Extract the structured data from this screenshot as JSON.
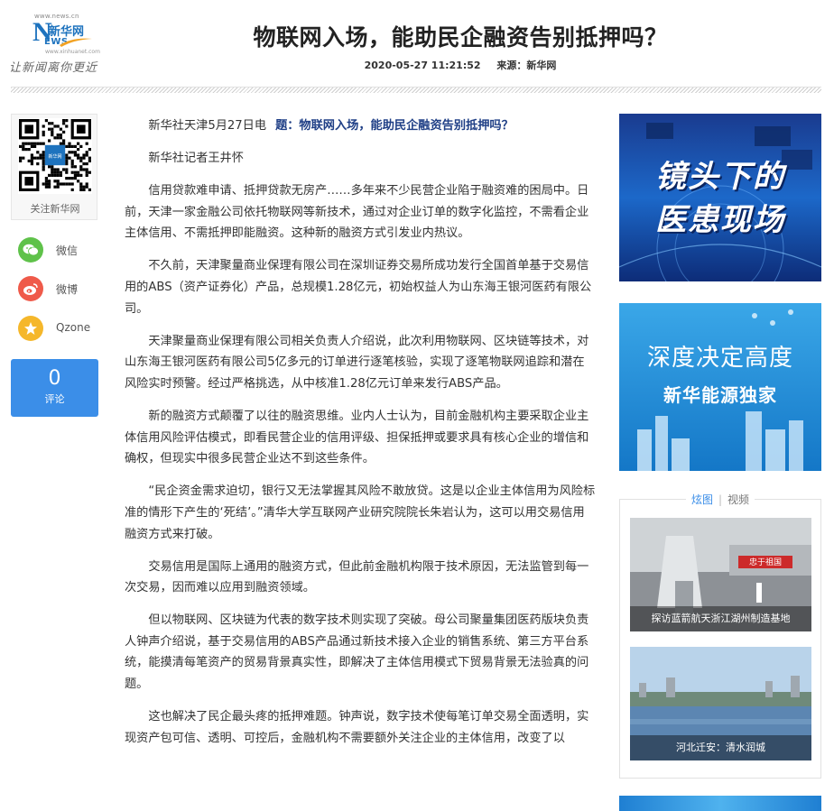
{
  "header": {
    "logo": {
      "url_top": "www.news.cn",
      "brand_cn": "新华网",
      "brand_letter": "N",
      "brand_en": "EWS",
      "url_bottom": "www.xinhuanet.com",
      "slogan": "让新闻离你更近"
    },
    "title": "物联网入场，能助民企融资告别抵押吗？",
    "datetime": "2020-05-27 11:21:52",
    "source": "来源：新华网"
  },
  "sidebar": {
    "qr_caption": "关注新华网",
    "qr_badge": "新华网",
    "share": [
      {
        "label": "微信",
        "icon": "wechat-icon",
        "color": "#5fc24a"
      },
      {
        "label": "微博",
        "icon": "weibo-icon",
        "color": "#ef5a4a"
      },
      {
        "label": "Qzone",
        "icon": "qzone-icon",
        "color": "#f5b72b"
      }
    ],
    "comment_count": "0",
    "comment_label": "评论"
  },
  "article": {
    "dateline": "新华社天津5月27日电",
    "lead_title": "题：物联网入场，能助民企融资告别抵押吗？",
    "byline": "新华社记者王井怀",
    "paragraphs": [
      "信用贷款难申请、抵押贷款无房产……多年来不少民营企业陷于融资难的困局中。日前，天津一家金融公司依托物联网等新技术，通过对企业订单的数字化监控，不需看企业主体信用、不需抵押即能融资。这种新的融资方式引发业内热议。",
      "不久前，天津聚量商业保理有限公司在深圳证券交易所成功发行全国首单基于交易信用的ABS（资产证券化）产品，总规模1.28亿元，初始权益人为山东海王银河医药有限公司。",
      "天津聚量商业保理有限公司相关负责人介绍说，此次利用物联网、区块链等技术，对山东海王银河医药有限公司5亿多元的订单进行逐笔核验，实现了逐笔物联网追踪和潜在风险实时预警。经过严格挑选，从中核准1.28亿元订单来发行ABS产品。",
      "新的融资方式颠覆了以往的融资思维。业内人士认为，目前金融机构主要采取企业主体信用风险评估模式，即看民营企业的信用评级、担保抵押或要求具有核心企业的增信和确权，但现实中很多民营企业达不到这些条件。",
      "“民企资金需求迫切，银行又无法掌握其风险不敢放贷。这是以企业主体信用为风险标准的情形下产生的‘死结’。”清华大学互联网产业研究院院长朱岩认为，这可以用交易信用融资方式来打破。",
      "交易信用是国际上通用的融资方式，但此前金融机构限于技术原因，无法监管到每一次交易，因而难以应用到融资领域。",
      "但以物联网、区块链为代表的数字技术则实现了突破。母公司聚量集团医药版块负责人钟声介绍说，基于交易信用的ABS产品通过新技术接入企业的销售系统、第三方平台系统，能摸清每笔资产的贸易背景真实性，即解决了主体信用模式下贸易背景无法验真的问题。",
      "这也解决了民企最头疼的抵押难题。钟声说，数字技术使每笔订单交易全面透明，实现资产包可信、透明、可控后，金融机构不需要额外关注企业的主体信用，改变了以"
    ]
  },
  "right": {
    "ad1": {
      "line1": "镜头下的",
      "line2": "医患现场"
    },
    "ad2": {
      "line1": "深度决定高度",
      "line2": "新华能源独家"
    },
    "media": {
      "tabs": [
        "炫图",
        "视频"
      ],
      "photos": [
        {
          "caption": "探访蓝箭航天浙江湖州制造基地",
          "sign": "忠于祖国"
        },
        {
          "caption": "河北迁安：清水润城"
        }
      ]
    }
  }
}
